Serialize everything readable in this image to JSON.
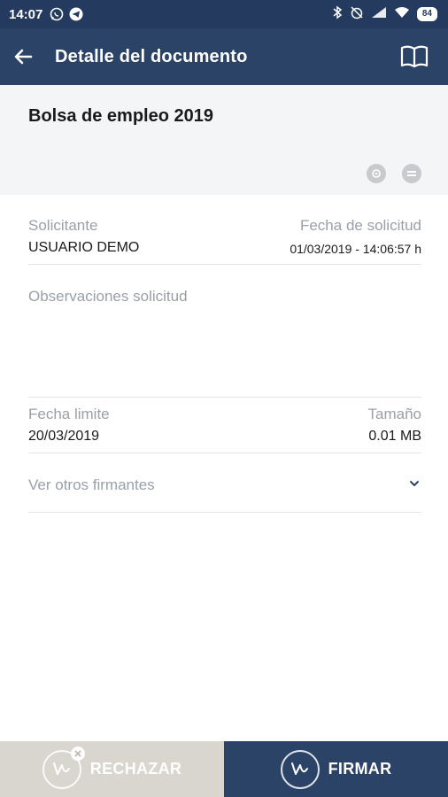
{
  "status_bar": {
    "time": "14:07",
    "battery": "84"
  },
  "app_bar": {
    "title": "Detalle del documento"
  },
  "document": {
    "title": "Bolsa de empleo 2019"
  },
  "fields": {
    "solicitante_label": "Solicitante",
    "solicitante_value": "USUARIO DEMO",
    "fecha_solicitud_label": "Fecha de solicitud",
    "fecha_solicitud_value": "01/03/2019 - 14:06:57 h",
    "observaciones_label": "Observaciones solicitud",
    "fecha_limite_label": "Fecha limite",
    "fecha_limite_value": "20/03/2019",
    "tamano_label": "Tamaño",
    "tamano_value": "0.01 MB",
    "otros_firmantes_label": "Ver otros firmantes"
  },
  "actions": {
    "reject_label": "RECHAZAR",
    "sign_label": "FIRMAR"
  },
  "colors": {
    "primary": "#2c4368",
    "status_bar": "#243a5e",
    "reject_bg": "#d8d6cf",
    "label_gray": "#9aa0a8"
  }
}
